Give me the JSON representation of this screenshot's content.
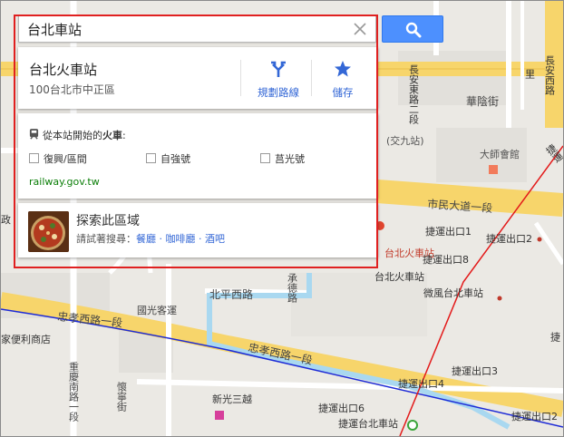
{
  "search": {
    "value": "台北車站"
  },
  "place": {
    "name": "台北火車站",
    "address": "100台北市中正區"
  },
  "actions": {
    "directions_label": "規劃路線",
    "save_label": "儲存"
  },
  "train": {
    "heading_prefix": "從本站開始的",
    "heading_bold": "火車",
    "heading_suffix": ":",
    "options": [
      "復興/區間",
      "自強號",
      "莒光號"
    ],
    "link": "railway.gov.tw"
  },
  "explore": {
    "title": "探索此區域",
    "prompt": "請試著搜尋：",
    "links": [
      "餐廳",
      "咖啡廳",
      "酒吧"
    ],
    "separator": "·"
  },
  "map_labels": {
    "changan_e_rd_2": "長安東路二段",
    "changan_w_rd": "長安西路",
    "huayin_st": "華陰街",
    "jiaosan": "(交九站)",
    "daxu": "大師會館",
    "civic_blvd": "市民大道一段",
    "taipei_station_label": "台北火車站",
    "mrt_exit1": "捷運出口1",
    "mrt_exit2": "捷運出口2",
    "mrt_exit3": "捷運出口3",
    "mrt_exit4": "捷運出口4",
    "mrt_exit6": "捷運出口6",
    "mrt_exit8": "捷運出口8",
    "taipei_train_station": "台北火車站",
    "weifeng": "微風台北車站",
    "beiping_w_rd": "北平西路",
    "chengde_rd": "承德路",
    "kuokuang": "國光客運",
    "zhongxiao_w_rd_1_a": "忠孝西路一段",
    "zhongxiao_w_rd_1_b": "忠孝西路一段",
    "convenience": "家便利商店",
    "huaining_st": "懷寧街",
    "chongqing_s_rd": "重慶南路一段",
    "shinkong": "新光三越",
    "mrt_taipei_station": "捷運台北車站",
    "zhengzhou": "政",
    "lei": "里",
    "mrt_vert": "捷運",
    "mrt_vert2": "捷"
  }
}
